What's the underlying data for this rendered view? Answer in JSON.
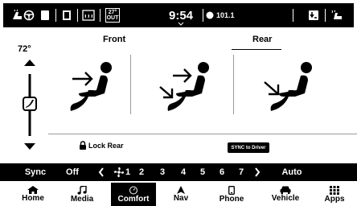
{
  "status_bar": {
    "outside_temp": "27°",
    "outside_label": "OUT",
    "time": "9:54",
    "radio_station": "101.1"
  },
  "tabs": [
    {
      "label": "Front",
      "selected": false
    },
    {
      "label": "Rear",
      "selected": true
    }
  ],
  "temperature": {
    "value": "72°",
    "level": 0.35
  },
  "seat_modes": [
    {
      "icon": "airflow-face-icon"
    },
    {
      "icon": "airflow-face-feet-icon"
    },
    {
      "icon": "airflow-feet-icon"
    }
  ],
  "lock_rear_label": "Lock Rear",
  "sync_button_label": "SYNC to Driver",
  "fan_bar": {
    "sync_label": "Sync",
    "off_label": "Off",
    "levels": [
      "1",
      "2",
      "3",
      "4",
      "5",
      "6",
      "7"
    ],
    "auto_label": "Auto"
  },
  "nav": [
    {
      "label": "Home",
      "icon": "home-icon",
      "active": false
    },
    {
      "label": "Media",
      "icon": "music-note-icon",
      "active": false
    },
    {
      "label": "Comfort",
      "icon": "comfort-icon",
      "active": true
    },
    {
      "label": "Nav",
      "icon": "navigation-arrow-icon",
      "active": false
    },
    {
      "label": "Phone",
      "icon": "phone-icon",
      "active": false
    },
    {
      "label": "Vehicle",
      "icon": "vehicle-icon",
      "active": false
    },
    {
      "label": "Apps",
      "icon": "apps-grid-icon",
      "active": false
    }
  ]
}
